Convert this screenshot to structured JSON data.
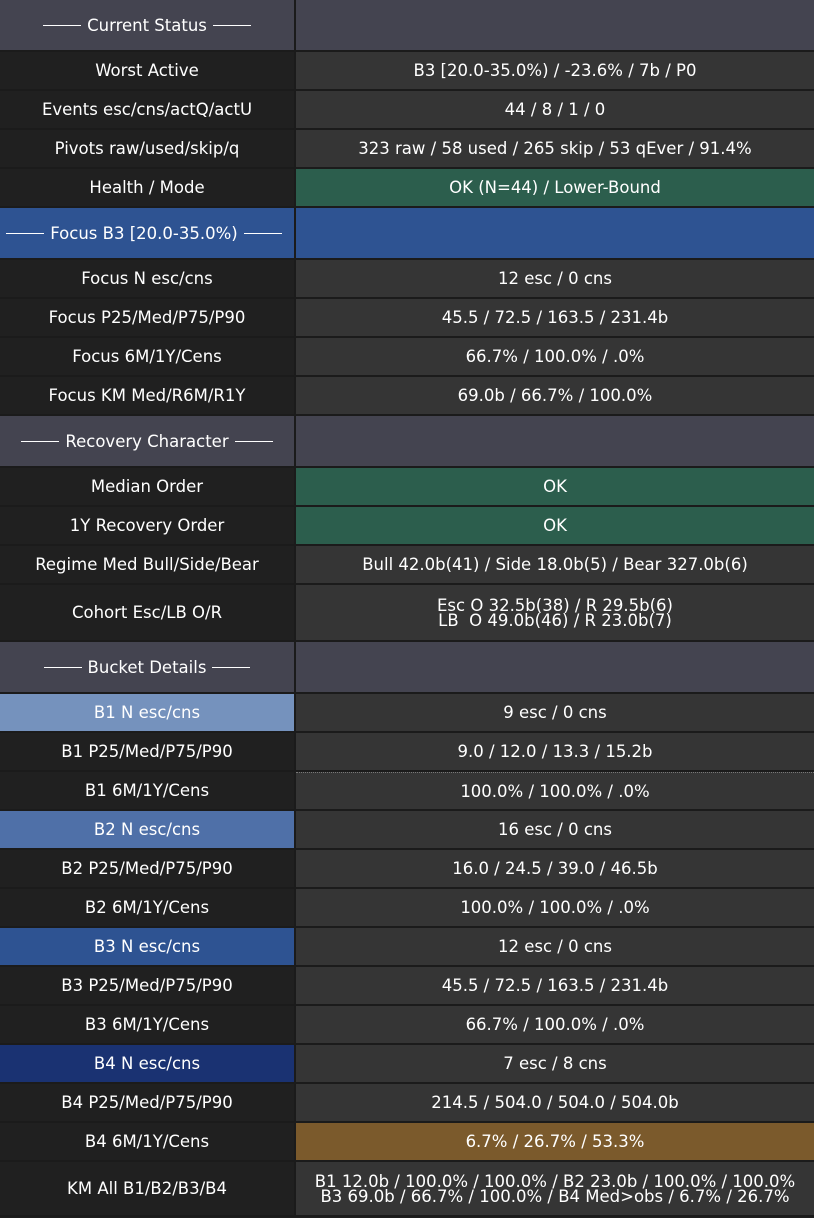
{
  "rows": [
    {
      "type": "header",
      "label": "Current Status",
      "value": "",
      "h": 52
    },
    {
      "type": "data",
      "label": "Worst Active",
      "value": "B3 [20.0-35.0%) / -23.6% / 7b / P0",
      "h": 39
    },
    {
      "type": "data",
      "label": "Events esc/cns/actQ/actU",
      "value": "44 / 8 / 1 / 0",
      "h": 39
    },
    {
      "type": "data",
      "label": "Pivots raw/used/skip/q",
      "value": "323 raw / 58 used / 265 skip / 53 qEver / 91.4%",
      "h": 39
    },
    {
      "type": "data",
      "label": "Health / Mode",
      "value": "OK (N=44) / Lower-Bound",
      "h": 39,
      "valueBg": "#2c5e4d"
    },
    {
      "type": "header",
      "label": "Focus B3 [20.0-35.0%)",
      "value": "",
      "h": 52,
      "bg": "#2e5392"
    },
    {
      "type": "data",
      "label": "Focus N esc/cns",
      "value": "12 esc / 0 cns",
      "h": 39
    },
    {
      "type": "data",
      "label": "Focus P25/Med/P75/P90",
      "value": "45.5 / 72.5 / 163.5 / 231.4b",
      "h": 39
    },
    {
      "type": "data",
      "label": "Focus 6M/1Y/Cens",
      "value": "66.7% / 100.0% / .0%",
      "h": 39
    },
    {
      "type": "data",
      "label": "Focus KM Med/R6M/R1Y",
      "value": "69.0b / 66.7% / 100.0%",
      "h": 39
    },
    {
      "type": "header",
      "label": "Recovery Character",
      "value": "",
      "h": 52
    },
    {
      "type": "data",
      "label": "Median Order",
      "value": "OK",
      "h": 39,
      "valueBg": "#2c5e4d"
    },
    {
      "type": "data",
      "label": "1Y Recovery Order",
      "value": "OK",
      "h": 39,
      "valueBg": "#2c5e4d"
    },
    {
      "type": "data",
      "label": "Regime Med Bull/Side/Bear",
      "value": "Bull 42.0b(41) / Side 18.0b(5) / Bear 327.0b(6)",
      "h": 39
    },
    {
      "type": "data",
      "label": "Cohort Esc/LB O/R",
      "value": "",
      "lines": [
        "Esc O 32.5b(38) / R 29.5b(6)",
        "LB  O 49.0b(46) / R 23.0b(7)"
      ],
      "h": 57
    },
    {
      "type": "header",
      "label": "Bucket Details",
      "value": "",
      "h": 52
    },
    {
      "type": "data",
      "label": "B1 N esc/cns",
      "value": "9 esc / 0 cns",
      "h": 39,
      "labelBg": "#7592bd"
    },
    {
      "type": "data",
      "label": "B1 P25/Med/P75/P90",
      "value": "9.0 / 12.0 / 13.3 / 15.2b",
      "h": 39
    },
    {
      "type": "data",
      "label": "B1 6M/1Y/Cens",
      "value": "100.0% / 100.0% / .0%",
      "h": 39,
      "dash": true
    },
    {
      "type": "data",
      "label": "B2 N esc/cns",
      "value": "16 esc / 0 cns",
      "h": 39,
      "labelBg": "#4f70a8"
    },
    {
      "type": "data",
      "label": "B2 P25/Med/P75/P90",
      "value": "16.0 / 24.5 / 39.0 / 46.5b",
      "h": 39
    },
    {
      "type": "data",
      "label": "B2 6M/1Y/Cens",
      "value": "100.0% / 100.0% / .0%",
      "h": 39
    },
    {
      "type": "data",
      "label": "B3 N esc/cns",
      "value": "12 esc / 0 cns",
      "h": 39,
      "labelBg": "#2e5392"
    },
    {
      "type": "data",
      "label": "B3 P25/Med/P75/P90",
      "value": "45.5 / 72.5 / 163.5 / 231.4b",
      "h": 39
    },
    {
      "type": "data",
      "label": "B3 6M/1Y/Cens",
      "value": "66.7% / 100.0% / .0%",
      "h": 39
    },
    {
      "type": "data",
      "label": "B4 N esc/cns",
      "value": "7 esc / 8 cns",
      "h": 39,
      "labelBg": "#1a3272"
    },
    {
      "type": "data",
      "label": "B4 P25/Med/P75/P90",
      "value": "214.5 / 504.0 / 504.0 / 504.0b",
      "h": 39
    },
    {
      "type": "data",
      "label": "B4 6M/1Y/Cens",
      "value": "6.7% / 26.7% / 53.3%",
      "h": 39,
      "valueBg": "#7b5a2c"
    },
    {
      "type": "data",
      "label": "KM All B1/B2/B3/B4",
      "value": "",
      "lines": [
        "B1 12.0b / 100.0% / 100.0% / B2 23.0b / 100.0% / 100.0%",
        "B3 69.0b / 66.7% / 100.0% / B4 Med>obs / 6.7% / 26.7%"
      ],
      "h": 55
    }
  ]
}
